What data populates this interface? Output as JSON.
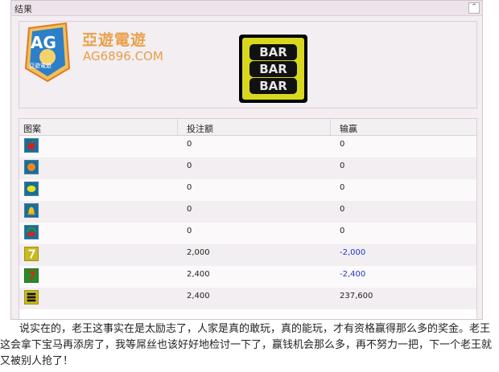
{
  "panel": {
    "title": "结果",
    "collapse_icon": "double-chevron-up-icon",
    "collapse_glyph": "⌃"
  },
  "brand": {
    "logo_text": "AG",
    "logo_subtext": "亞遊電遊",
    "name": "亞遊電遊",
    "url": "AG6896.COM"
  },
  "result_symbol": {
    "icon": "triple-bar-icon",
    "tiles": [
      "BAR",
      "BAR",
      "BAR"
    ]
  },
  "table": {
    "headers": [
      "图案",
      "投注额",
      "输赢"
    ],
    "rows": [
      {
        "icon": "cherry-icon",
        "bet": "0",
        "win": "0",
        "negative": false
      },
      {
        "icon": "orange-icon",
        "bet": "0",
        "win": "0",
        "negative": false
      },
      {
        "icon": "lemon-icon",
        "bet": "0",
        "win": "0",
        "negative": false
      },
      {
        "icon": "bell-icon",
        "bet": "0",
        "win": "0",
        "negative": false
      },
      {
        "icon": "watermelon-icon",
        "bet": "0",
        "win": "0",
        "negative": false
      },
      {
        "icon": "gold-seven-icon",
        "bet": "2,000",
        "win": "-2,000",
        "negative": true
      },
      {
        "icon": "red-seven-icon",
        "bet": "2,400",
        "win": "-2,400",
        "negative": true
      },
      {
        "icon": "bar-icon",
        "bet": "2,400",
        "win": "237,600",
        "negative": false
      }
    ]
  },
  "caption": "说实在的，老王这事实在是太励志了，人家是真的敢玩，真的能玩，才有资格赢得那么多的奖金。老王这会拿下宝马再添房了，我等屌丝也该好好地检讨一下了，赢钱机会那么多，再不努力一把，下一个老王就又被别人抢了！"
}
